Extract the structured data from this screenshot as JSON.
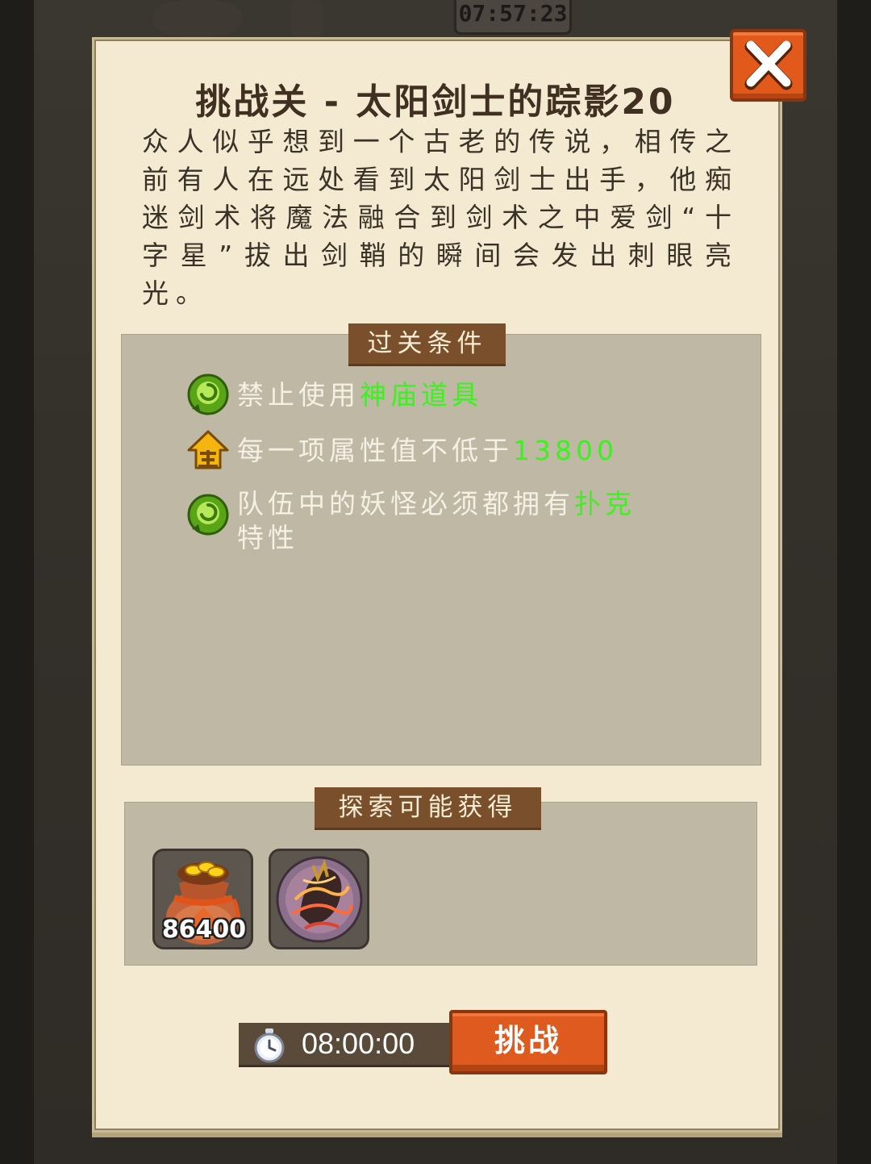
{
  "background": {
    "clock": "07:57:23"
  },
  "dialog": {
    "title": "挑战关 - 太阳剑士的踪影20",
    "story": "众人似乎想到一个古老的传说，相传之前有人在远处看到太阳剑士出手，他痴迷剑术将魔法融合到剑术之中爱剑“十字星”拔出剑鞘的瞬间会发出刺眼亮光。",
    "close_icon": "close-x-icon"
  },
  "conditions": {
    "header": "过关条件",
    "items": [
      {
        "icon": "green-swirl-icon",
        "text": "禁止使用",
        "highlight": "神庙道具",
        "after": ""
      },
      {
        "icon": "gold-quan-icon",
        "text": "每一项属性值不低于",
        "highlight": "13800",
        "after": ""
      },
      {
        "icon": "green-swirl-icon",
        "text": "队伍中的妖怪必须都拥有",
        "highlight": "扑克",
        "after": "特性"
      }
    ]
  },
  "rewards": {
    "header": "探索可能获得",
    "items": [
      {
        "icon": "coin-bag-icon",
        "count": "86400"
      },
      {
        "icon": "dragon-orb-icon",
        "count": ""
      }
    ]
  },
  "footer": {
    "timer_icon": "stopwatch-icon",
    "timer": "08:00:00",
    "challenge_label": "挑战"
  },
  "colors": {
    "highlight": "#3cf21e",
    "button": "#de5a1e",
    "tag": "#7a4f2c",
    "parchment": "#f3ead1"
  }
}
